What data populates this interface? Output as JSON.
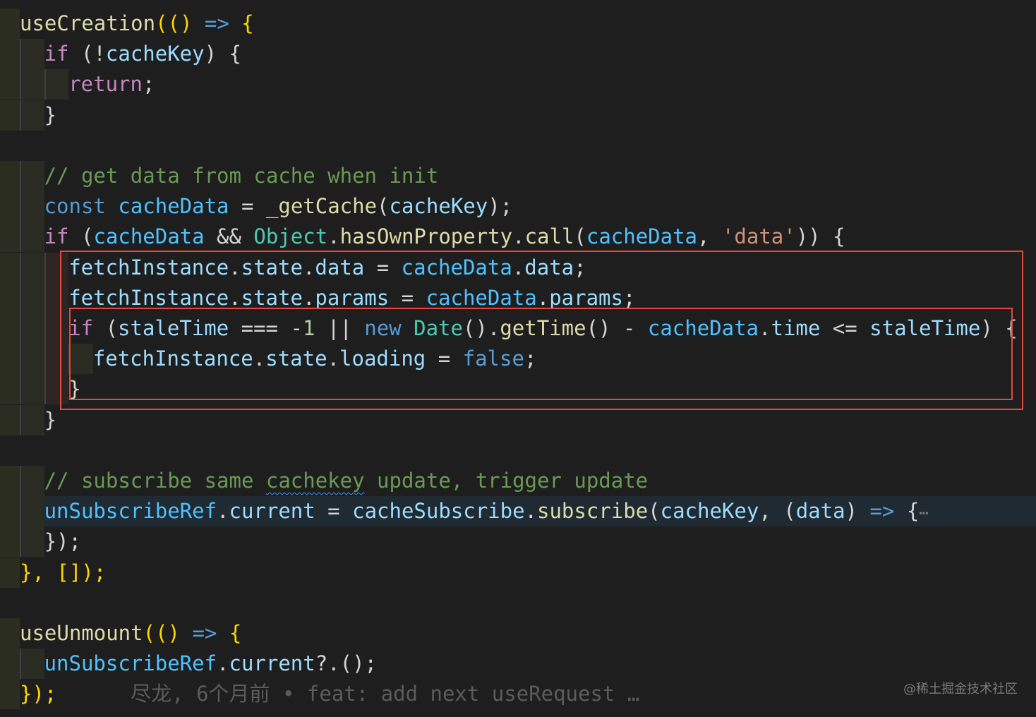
{
  "editor": {
    "lines": [
      [
        {
          "t": "useCreation",
          "c": "fn"
        },
        {
          "t": "(() ",
          "c": "y"
        },
        {
          "t": "=>",
          "c": "kw"
        },
        {
          "t": " {",
          "c": "y"
        }
      ],
      [
        {
          "t": "if",
          "c": "ctl"
        },
        {
          "t": " (!",
          "c": "p"
        },
        {
          "t": "cacheKey",
          "c": "var"
        },
        {
          "t": ") {",
          "c": "p"
        }
      ],
      [
        {
          "t": "return",
          "c": "ctl"
        },
        {
          "t": ";",
          "c": "p"
        }
      ],
      [
        {
          "t": "}",
          "c": "p"
        }
      ],
      [],
      [
        {
          "t": "// get data from cache when init",
          "c": "cmt"
        }
      ],
      [
        {
          "t": "const",
          "c": "kw"
        },
        {
          "t": " ",
          "c": "p"
        },
        {
          "t": "cacheData",
          "c": "const"
        },
        {
          "t": " = ",
          "c": "p"
        },
        {
          "t": "_getCache",
          "c": "fn"
        },
        {
          "t": "(",
          "c": "p"
        },
        {
          "t": "cacheKey",
          "c": "var"
        },
        {
          "t": ");",
          "c": "p"
        }
      ],
      [
        {
          "t": "if",
          "c": "ctl"
        },
        {
          "t": " (",
          "c": "p"
        },
        {
          "t": "cacheData",
          "c": "const"
        },
        {
          "t": " && ",
          "c": "p"
        },
        {
          "t": "Object",
          "c": "cls"
        },
        {
          "t": ".",
          "c": "p"
        },
        {
          "t": "hasOwnProperty",
          "c": "fn"
        },
        {
          "t": ".",
          "c": "p"
        },
        {
          "t": "call",
          "c": "fn"
        },
        {
          "t": "(",
          "c": "p"
        },
        {
          "t": "cacheData",
          "c": "const"
        },
        {
          "t": ", ",
          "c": "p"
        },
        {
          "t": "'data'",
          "c": "str"
        },
        {
          "t": ")) {",
          "c": "p"
        }
      ],
      [
        {
          "t": "fetchInstance",
          "c": "var"
        },
        {
          "t": ".",
          "c": "p"
        },
        {
          "t": "state",
          "c": "var"
        },
        {
          "t": ".",
          "c": "p"
        },
        {
          "t": "data",
          "c": "var"
        },
        {
          "t": " = ",
          "c": "p"
        },
        {
          "t": "cacheData",
          "c": "const"
        },
        {
          "t": ".",
          "c": "p"
        },
        {
          "t": "data",
          "c": "var"
        },
        {
          "t": ";",
          "c": "p"
        }
      ],
      [
        {
          "t": "fetchInstance",
          "c": "var"
        },
        {
          "t": ".",
          "c": "p"
        },
        {
          "t": "state",
          "c": "var"
        },
        {
          "t": ".",
          "c": "p"
        },
        {
          "t": "params",
          "c": "var"
        },
        {
          "t": " = ",
          "c": "p"
        },
        {
          "t": "cacheData",
          "c": "const"
        },
        {
          "t": ".",
          "c": "p"
        },
        {
          "t": "params",
          "c": "var"
        },
        {
          "t": ";",
          "c": "p"
        }
      ],
      [
        {
          "t": "if",
          "c": "ctl"
        },
        {
          "t": " (",
          "c": "p"
        },
        {
          "t": "staleTime",
          "c": "var"
        },
        {
          "t": " === -",
          "c": "p"
        },
        {
          "t": "1",
          "c": "num"
        },
        {
          "t": " || ",
          "c": "p"
        },
        {
          "t": "new",
          "c": "kw"
        },
        {
          "t": " ",
          "c": "p"
        },
        {
          "t": "Date",
          "c": "cls"
        },
        {
          "t": "().",
          "c": "p"
        },
        {
          "t": "getTime",
          "c": "fn"
        },
        {
          "t": "() - ",
          "c": "p"
        },
        {
          "t": "cacheData",
          "c": "const"
        },
        {
          "t": ".",
          "c": "p"
        },
        {
          "t": "time",
          "c": "var"
        },
        {
          "t": " <= ",
          "c": "p"
        },
        {
          "t": "staleTime",
          "c": "var"
        },
        {
          "t": ") {",
          "c": "p"
        }
      ],
      [
        {
          "t": "fetchInstance",
          "c": "var"
        },
        {
          "t": ".",
          "c": "p"
        },
        {
          "t": "state",
          "c": "var"
        },
        {
          "t": ".",
          "c": "p"
        },
        {
          "t": "loading",
          "c": "var"
        },
        {
          "t": " = ",
          "c": "p"
        },
        {
          "t": "false",
          "c": "kw"
        },
        {
          "t": ";",
          "c": "p"
        }
      ],
      [
        {
          "t": "}",
          "c": "p"
        }
      ],
      [
        {
          "t": "}",
          "c": "p"
        }
      ],
      [],
      [
        {
          "t": "// subscribe same ",
          "c": "cmt"
        },
        {
          "t": "cachekey",
          "c": "cmt",
          "sq": true
        },
        {
          "t": " update, trigger update",
          "c": "cmt"
        }
      ],
      [
        {
          "t": "unSubscribeRef",
          "c": "const"
        },
        {
          "t": ".",
          "c": "p"
        },
        {
          "t": "current",
          "c": "var"
        },
        {
          "t": " = ",
          "c": "p"
        },
        {
          "t": "cacheSubscribe",
          "c": "var"
        },
        {
          "t": ".",
          "c": "p"
        },
        {
          "t": "subscribe",
          "c": "fn"
        },
        {
          "t": "(",
          "c": "p"
        },
        {
          "t": "cacheKey",
          "c": "var"
        },
        {
          "t": ", (",
          "c": "p"
        },
        {
          "t": "data",
          "c": "var"
        },
        {
          "t": ") ",
          "c": "p"
        },
        {
          "t": "=>",
          "c": "kw"
        },
        {
          "t": " {",
          "c": "p"
        },
        {
          "t": "⋯",
          "c": "ellipsis"
        }
      ],
      [
        {
          "t": "});",
          "c": "p"
        }
      ],
      [
        {
          "t": "}, []);",
          "c": "y"
        }
      ],
      [],
      [
        {
          "t": "useUnmount",
          "c": "fn"
        },
        {
          "t": "(() ",
          "c": "y"
        },
        {
          "t": "=>",
          "c": "kw"
        },
        {
          "t": " {",
          "c": "y"
        }
      ],
      [
        {
          "t": "unSubscribeRef",
          "c": "const"
        },
        {
          "t": ".",
          "c": "p"
        },
        {
          "t": "current",
          "c": "var"
        },
        {
          "t": "?.();",
          "c": "p"
        }
      ],
      [
        {
          "t": "});",
          "c": "y"
        }
      ]
    ],
    "blame": "尽龙, 6个月前 • feat: add next useRequest …"
  },
  "watermark": "@稀土掘金技术社区",
  "colors": {
    "background": "#1e1e1e",
    "highlight_box": "#e5483f"
  }
}
